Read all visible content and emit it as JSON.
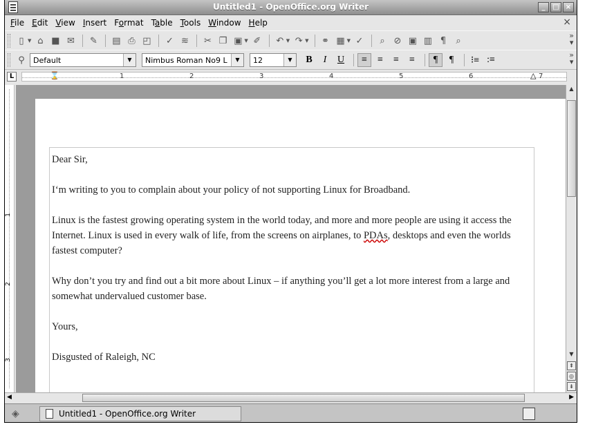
{
  "window": {
    "title": "Untitled1 - OpenOffice.org Writer",
    "min": "_",
    "max": "□",
    "close": "×"
  },
  "menubar": {
    "items": [
      {
        "pre": "",
        "ul": "F",
        "post": "ile"
      },
      {
        "pre": "",
        "ul": "E",
        "post": "dit"
      },
      {
        "pre": "",
        "ul": "V",
        "post": "iew"
      },
      {
        "pre": "",
        "ul": "I",
        "post": "nsert"
      },
      {
        "pre": "F",
        "ul": "o",
        "post": "rmat"
      },
      {
        "pre": "T",
        "ul": "a",
        "post": "ble"
      },
      {
        "pre": "",
        "ul": "T",
        "post": "ools"
      },
      {
        "pre": "",
        "ul": "W",
        "post": "indow"
      },
      {
        "pre": "",
        "ul": "H",
        "post": "elp"
      }
    ],
    "close": "×"
  },
  "formatting": {
    "style": "Default",
    "font": "Nimbus Roman No9 L",
    "size": "12",
    "bold": "B",
    "italic": "I",
    "underline": "U"
  },
  "ruler": {
    "ticks": [
      "1",
      "2",
      "3",
      "4",
      "5",
      "6",
      "7"
    ],
    "vticks": [
      "1",
      "2",
      "3"
    ],
    "corner": "L"
  },
  "document": {
    "salutation": "Dear Sir,",
    "p1": "I‘m writing to you to complain about your policy of not supporting Linux for Broadband.",
    "p2_pre": "Linux is the fastest growing operating system in the world today, and more and more people are using it access the Internet. Linux is used in every walk of life, from the screens on airplanes, to ",
    "p2_spell": "PDAs",
    "p2_post": ", desktops and even the worlds fastest computer?",
    "p3": "Why don’t you try and find out a bit more about Linux – if anything you’ll get a lot more interest from a large and somewhat undervalued customer base.",
    "closing": "Yours,",
    "signature": "Disgusted of Raleigh, NC"
  },
  "taskbar": {
    "tab_label": "Untitled1 - OpenOffice.org Writer"
  }
}
